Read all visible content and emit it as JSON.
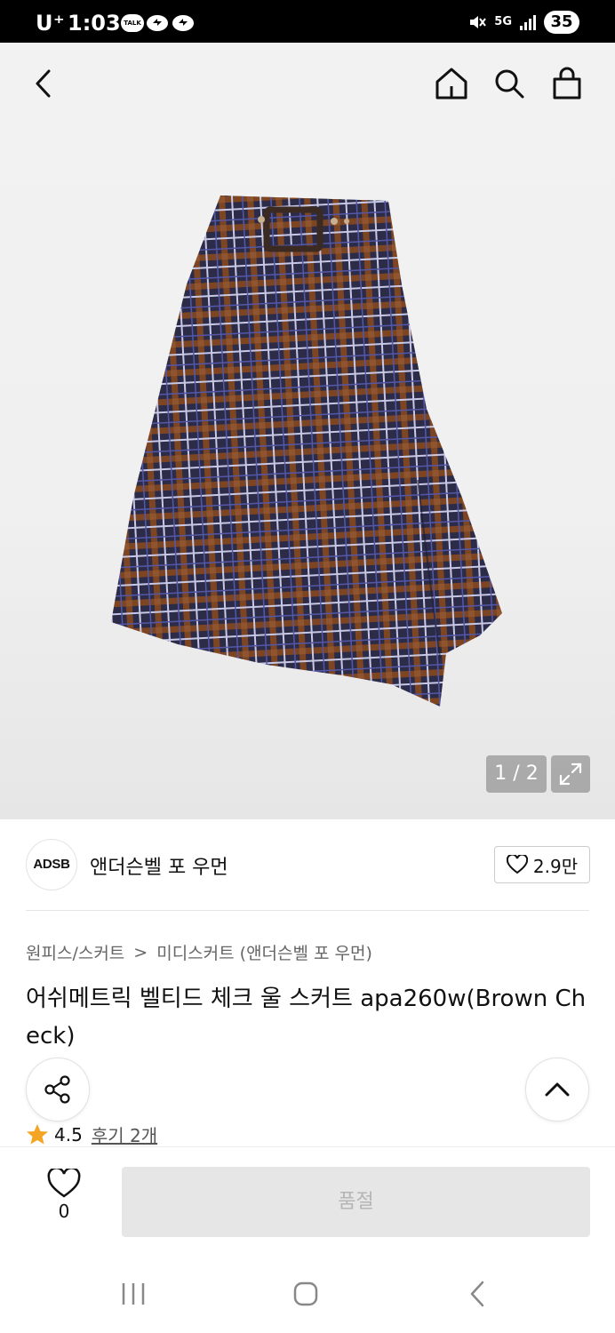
{
  "status_bar": {
    "carrier": "U⁺",
    "time": "1:03",
    "talk_badge": "TALK",
    "network": "5G",
    "battery": "35"
  },
  "header": {
    "icons": [
      "back-icon",
      "home-icon",
      "search-icon",
      "shopping-bag-icon"
    ]
  },
  "gallery": {
    "pager": "1 / 2"
  },
  "brand": {
    "logo_text": "ADSB",
    "name": "앤더슨벨 포 우먼",
    "likes": "2.9만"
  },
  "breadcrumb": {
    "category": "원피스/스커트",
    "separator": ">",
    "subcategory": "미디스커트 (앤더슨벨 포 우먼)"
  },
  "product": {
    "title": "어쉬메트릭 벨티드 체크 울 스커트 apa260w(Brown Check)",
    "rating": "4.5",
    "reviews": "후기 2개"
  },
  "bottom_bar": {
    "wish_count": "0",
    "buy_label": "품절"
  },
  "colors": {
    "star": "#f5a524",
    "skirt_base": "#2c2c48",
    "skirt_brown": "#8a4a24",
    "soldout_bg": "#e6e6e6"
  }
}
